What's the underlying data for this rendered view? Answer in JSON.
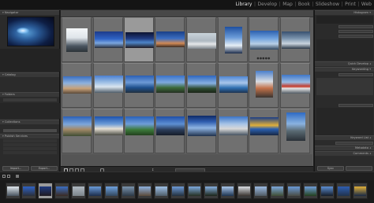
{
  "identity": {
    "line1": "",
    "line2": ""
  },
  "modules": [
    {
      "label": "Library",
      "active": true
    },
    {
      "label": "Develop",
      "active": false
    },
    {
      "label": "Map",
      "active": false
    },
    {
      "label": "Book",
      "active": false
    },
    {
      "label": "Slideshow",
      "active": false
    },
    {
      "label": "Print",
      "active": false
    },
    {
      "label": "Web",
      "active": false
    }
  ],
  "left_panel": {
    "navigator_label": "Navigator",
    "catalog_label": "Catalog",
    "catalog_items": [
      {
        "label": "",
        "count": ""
      },
      {
        "label": "",
        "count": ""
      },
      {
        "label": "",
        "count": ""
      },
      {
        "label": "",
        "count": ""
      }
    ],
    "folders_label": "Folders",
    "collections_label": "Collections",
    "collection_items": [
      {
        "label": "",
        "count": "",
        "selected": false
      },
      {
        "label": "",
        "count": "",
        "selected": true
      }
    ],
    "publish_label": "Publish Services",
    "import_button": "Import...",
    "export_button": "Export..."
  },
  "toolbar": {
    "sort_label": "",
    "sort_value": ""
  },
  "right_panel": {
    "histogram_label": "Histogram",
    "quick_develop_label": "Quick Develop",
    "quick_develop_fields": [
      {
        "label": "",
        "value": ""
      },
      {
        "label": "",
        "value": ""
      },
      {
        "label": "",
        "value": ""
      }
    ],
    "keywording_label": "Keywording",
    "keyword_tags_label": "",
    "keyword_tags_value": "",
    "keyword_list_label": "Keyword List",
    "metadata_label": "Metadata",
    "comments_label": "Comments",
    "sync_button": "Sync",
    "sync_settings_button": ""
  },
  "filmstrip": {
    "path": ""
  },
  "icons": [
    "grid-view-icon",
    "loupe-view-icon",
    "compare-view-icon",
    "survey-view-icon",
    "painter-icon",
    "sort-direction-icon",
    "disclosure-triangle-icon"
  ],
  "colors": {
    "panel": "#2b2b2b",
    "grid": "#5e5e5e",
    "cell": "#707070",
    "selected_cell": "#9a9a9a",
    "active_module": "#e6e6e6"
  }
}
